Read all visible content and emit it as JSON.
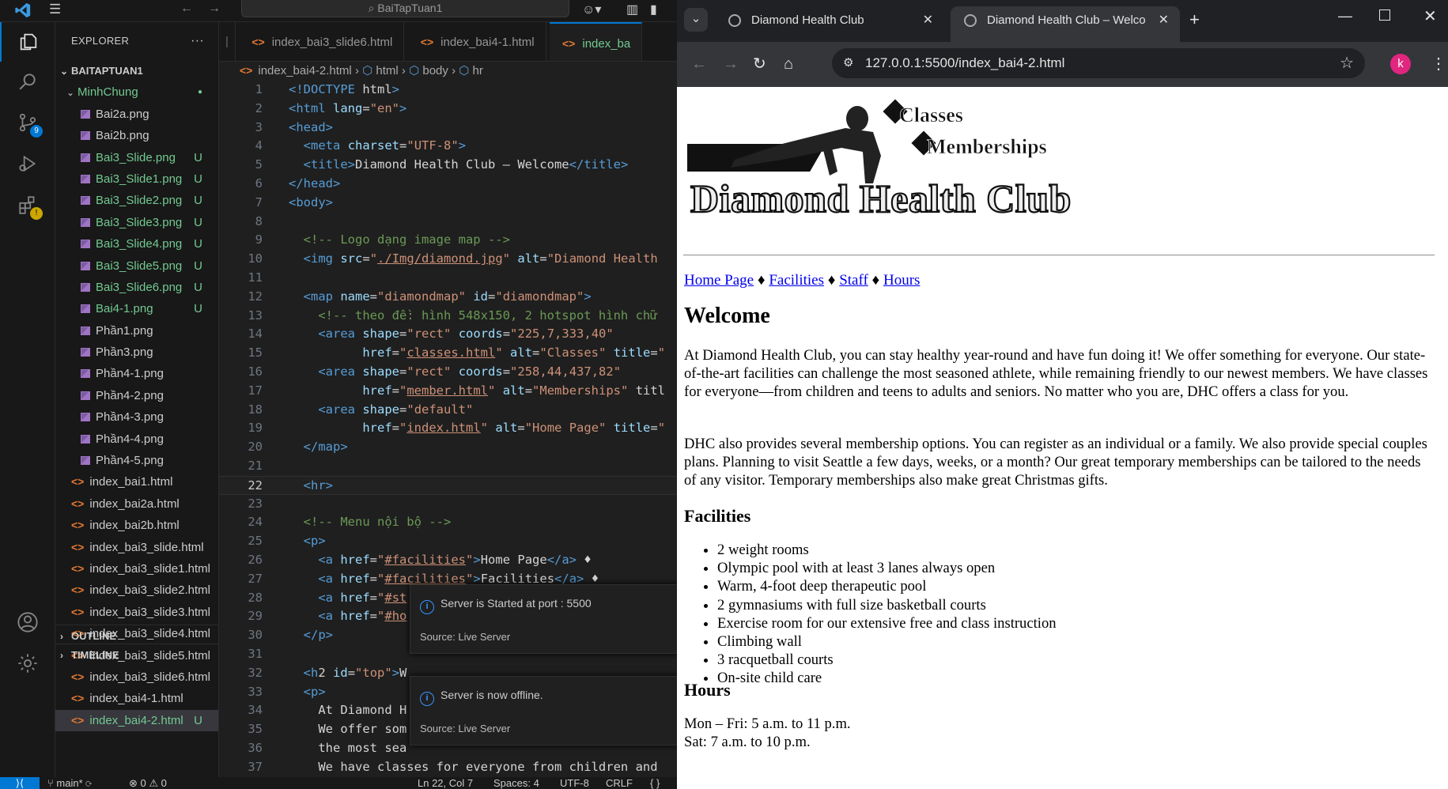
{
  "vscode": {
    "titlebar": {
      "search": "BaiTapTuan1"
    },
    "activity": {
      "scm_badge": "9"
    },
    "explorer": {
      "title": "EXPLORER",
      "root": "BAITAPTUAN1",
      "folder": "MinhChung",
      "images": [
        {
          "name": "Bai2a.png",
          "status": ""
        },
        {
          "name": "Bai2b.png",
          "status": ""
        },
        {
          "name": "Bai3_Slide.png",
          "status": "U"
        },
        {
          "name": "Bai3_Slide1.png",
          "status": "U"
        },
        {
          "name": "Bai3_Slide2.png",
          "status": "U"
        },
        {
          "name": "Bai3_Slide3.png",
          "status": "U"
        },
        {
          "name": "Bai3_Slide4.png",
          "status": "U"
        },
        {
          "name": "Bai3_Slide5.png",
          "status": "U"
        },
        {
          "name": "Bai3_Slide6.png",
          "status": "U"
        },
        {
          "name": "Bai4-1.png",
          "status": "U"
        },
        {
          "name": "Phần1.png",
          "status": ""
        },
        {
          "name": "Phần3.png",
          "status": ""
        },
        {
          "name": "Phần4-1.png",
          "status": ""
        },
        {
          "name": "Phần4-2.png",
          "status": ""
        },
        {
          "name": "Phần4-3.png",
          "status": ""
        },
        {
          "name": "Phần4-4.png",
          "status": ""
        },
        {
          "name": "Phần4-5.png",
          "status": ""
        }
      ],
      "files": [
        {
          "name": "index_bai1.html",
          "status": ""
        },
        {
          "name": "index_bai2a.html",
          "status": ""
        },
        {
          "name": "index_bai2b.html",
          "status": ""
        },
        {
          "name": "index_bai3_slide.html",
          "status": ""
        },
        {
          "name": "index_bai3_slide1.html",
          "status": ""
        },
        {
          "name": "index_bai3_slide2.html",
          "status": ""
        },
        {
          "name": "index_bai3_slide3.html",
          "status": ""
        },
        {
          "name": "index_bai3_slide4.html",
          "status": ""
        },
        {
          "name": "index_bai3_slide5.html",
          "status": ""
        },
        {
          "name": "index_bai3_slide6.html",
          "status": ""
        },
        {
          "name": "index_bai4-1.html",
          "status": ""
        },
        {
          "name": "index_bai4-2.html",
          "status": "U"
        }
      ],
      "outline": "OUTLINE",
      "timeline": "TIMELINE"
    },
    "tabs": [
      {
        "label": "index_bai3_slide6.html"
      },
      {
        "label": "index_bai4-1.html"
      },
      {
        "label": "index_ba"
      }
    ],
    "breadcrumbs": [
      "index_bai4-2.html",
      "html",
      "body",
      "hr"
    ],
    "code": [
      "<!DOCTYPE html>",
      "<html lang=\"en\">",
      "<head>",
      "  <meta charset=\"UTF-8\">",
      "  <title>Diamond Health Club – Welcome</title>",
      "</head>",
      "<body>",
      "",
      "  <!-- Logo dạng image map -->",
      "  <img src=\"./Img/diamond.jpg\" alt=\"Diamond Health",
      "",
      "  <map name=\"diamondmap\" id=\"diamondmap\">",
      "    <!-- theo đề: hình 548x150, 2 hotspot hình chữ",
      "    <area shape=\"rect\" coords=\"225,7,333,40\"",
      "          href=\"classes.html\" alt=\"Classes\" title=\"",
      "    <area shape=\"rect\" coords=\"258,44,437,82\"",
      "          href=\"member.html\" alt=\"Memberships\" titl",
      "    <area shape=\"default\"",
      "          href=\"index.html\" alt=\"Home Page\" title=\"",
      "  </map>",
      "",
      "  <hr>",
      "",
      "  <!-- Menu nội bộ -->",
      "  <p>",
      "    <a href=\"#facilities\">Home Page</a> ♦",
      "    <a href=\"#facilities\">Facilities</a> ♦",
      "    <a href=\"#st",
      "    <a href=\"#ho",
      "  </p>",
      "",
      "  <h2 id=\"top\">W",
      "  <p>",
      "    At Diamond H",
      "    We offer som",
      "    the most sea",
      "    We have classes for everyone from children and"
    ],
    "current_line": 22,
    "toasts": [
      {
        "message": "Server is Started at port : 5500",
        "source": "Source: Live Server"
      },
      {
        "message": "Server is now offline.",
        "source": "Source: Live Server"
      }
    ],
    "status": {
      "branch": "main*",
      "problems": "⊗ 0 ⚠ 0",
      "position": "Ln 22, Col 7",
      "spaces": "Spaces: 4",
      "encoding": "UTF-8",
      "eol": "CRLF",
      "lang": "{ }"
    }
  },
  "browser": {
    "tabs": [
      {
        "title": "Diamond Health Club"
      },
      {
        "title": "Diamond Health Club – Welcome"
      }
    ],
    "url": "127.0.0.1:5500/index_bai4-2.html",
    "profile": "k",
    "page": {
      "logo": {
        "line1": "Classes",
        "line2": "Memberships",
        "brand": "Diamond Health Club"
      },
      "nav": [
        "Home Page",
        "Facilities",
        "Staff",
        "Hours"
      ],
      "nav_sep": "♦",
      "welcome_heading": "Welcome",
      "para1": "At Diamond Health Club, you can stay healthy year-round and have fun doing it! We offer something for everyone. Our state-of-the-art facilities can challenge the most seasoned athlete, while remaining friendly to our newest members. We have classes for everyone—from children and teens to adults and seniors. No matter who you are, DHC offers a class for you.",
      "para2": "DHC also provides several membership options. You can register as an individual or a family. We also provide special couples plans. Planning to visit Seattle a few days, weeks, or a month? Our great temporary memberships can be tailored to the needs of any visitor. Temporary memberships also make great Christmas gifts.",
      "facilities_heading": "Facilities",
      "facilities": [
        "2 weight rooms",
        "Olympic pool with at least 3 lanes always open",
        "Warm, 4-foot deep therapeutic pool",
        "2 gymnasiums with full size basketball courts",
        "Exercise room for our extensive free and class instruction",
        "Climbing wall",
        "3 racquetball courts",
        "On-site child care"
      ],
      "hours_heading": "Hours",
      "hours": [
        "Mon – Fri: 5 a.m. to 11 p.m.",
        "Sat: 7 a.m. to 10 p.m."
      ]
    }
  }
}
